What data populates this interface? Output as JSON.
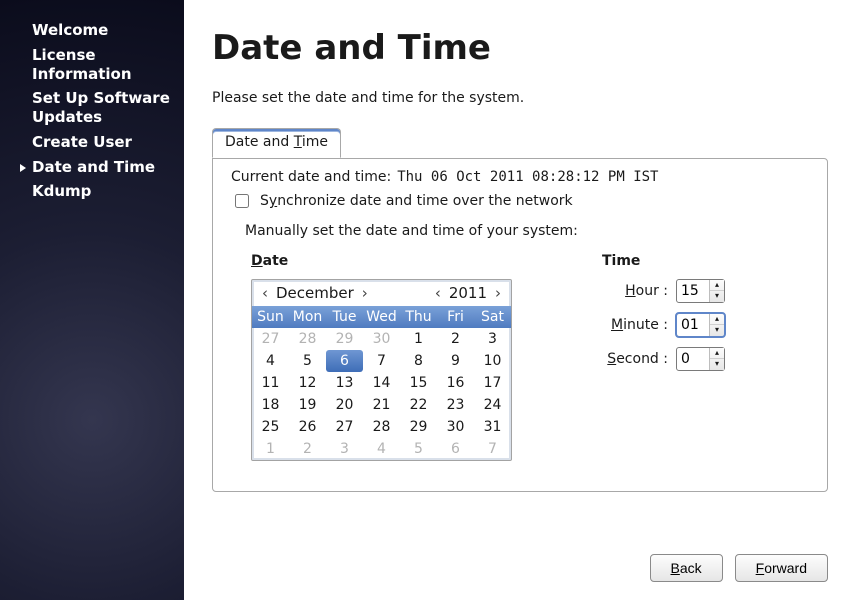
{
  "sidebar": {
    "items": [
      {
        "label": "Welcome",
        "active": false
      },
      {
        "label": "License Information",
        "active": false
      },
      {
        "label": "Set Up Software Updates",
        "active": false
      },
      {
        "label": "Create User",
        "active": false
      },
      {
        "label": "Date and Time",
        "active": true
      },
      {
        "label": "Kdump",
        "active": false
      }
    ]
  },
  "page": {
    "title": "Date and Time",
    "description": "Please set the date and time for the system."
  },
  "tab": {
    "label_pre": "Date and ",
    "label_u": "T",
    "label_post": "ime"
  },
  "panel": {
    "current_label": "Current date and time:",
    "current_value": "Thu 06 Oct 2011 08:28:12 PM IST",
    "sync_checked": false,
    "sync_pre": "S",
    "sync_u": "y",
    "sync_post": "nchronize date and time over the network",
    "manual_label": "Manually set the date and time of your system:",
    "date_u": "D",
    "date_post": "ate",
    "time_title": "Time"
  },
  "calendar": {
    "month": "December",
    "year": "2011",
    "dayheaders": [
      "Sun",
      "Mon",
      "Tue",
      "Wed",
      "Thu",
      "Fri",
      "Sat"
    ],
    "weeks": [
      [
        {
          "n": 27,
          "dim": true
        },
        {
          "n": 28,
          "dim": true
        },
        {
          "n": 29,
          "dim": true
        },
        {
          "n": 30,
          "dim": true
        },
        {
          "n": 1
        },
        {
          "n": 2
        },
        {
          "n": 3
        }
      ],
      [
        {
          "n": 4
        },
        {
          "n": 5
        },
        {
          "n": 6,
          "sel": true
        },
        {
          "n": 7
        },
        {
          "n": 8
        },
        {
          "n": 9
        },
        {
          "n": 10
        }
      ],
      [
        {
          "n": 11
        },
        {
          "n": 12
        },
        {
          "n": 13
        },
        {
          "n": 14
        },
        {
          "n": 15
        },
        {
          "n": 16
        },
        {
          "n": 17
        }
      ],
      [
        {
          "n": 18
        },
        {
          "n": 19
        },
        {
          "n": 20
        },
        {
          "n": 21
        },
        {
          "n": 22
        },
        {
          "n": 23
        },
        {
          "n": 24
        }
      ],
      [
        {
          "n": 25
        },
        {
          "n": 26
        },
        {
          "n": 27
        },
        {
          "n": 28
        },
        {
          "n": 29
        },
        {
          "n": 30
        },
        {
          "n": 31
        }
      ],
      [
        {
          "n": 1,
          "dim": true
        },
        {
          "n": 2,
          "dim": true
        },
        {
          "n": 3,
          "dim": true
        },
        {
          "n": 4,
          "dim": true
        },
        {
          "n": 5,
          "dim": true
        },
        {
          "n": 6,
          "dim": true
        },
        {
          "n": 7,
          "dim": true
        }
      ]
    ]
  },
  "time": {
    "hour_u": "H",
    "hour_post": "our :",
    "hour_value": "15",
    "minute_u": "M",
    "minute_post": "inute :",
    "minute_value": "01",
    "second_u": "S",
    "second_post": "econd :",
    "second_value": "0"
  },
  "footer": {
    "back_u": "B",
    "back_post": "ack",
    "forward_u": "F",
    "forward_post": "orward"
  },
  "glyph": {
    "left": "‹",
    "right": "›",
    "up": "▴",
    "down": "▾"
  }
}
